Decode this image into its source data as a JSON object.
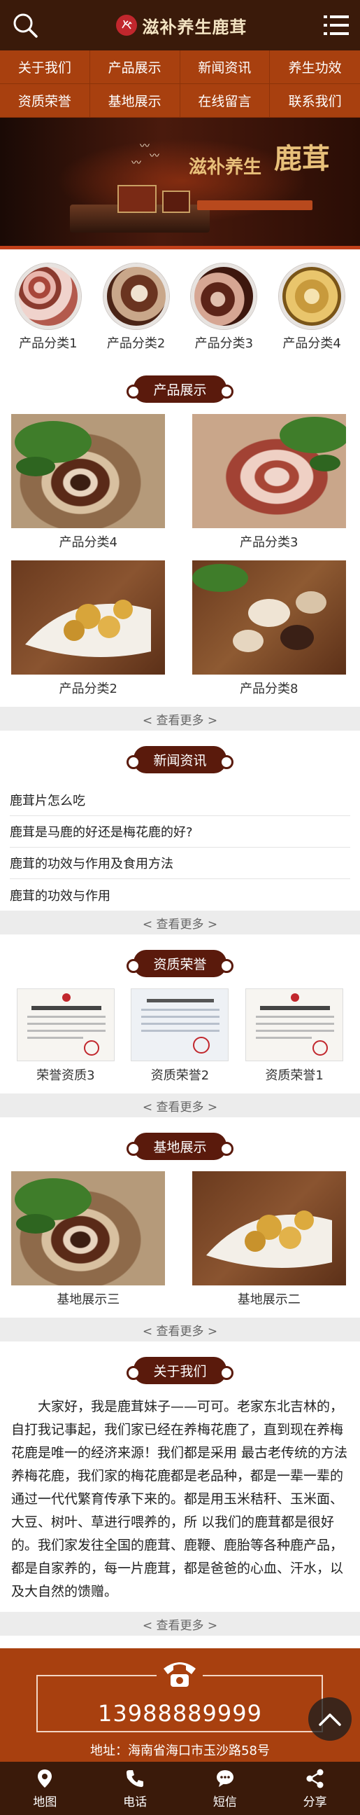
{
  "header": {
    "site_name": "滋补养生鹿茸"
  },
  "nav": {
    "items": [
      "关于我们",
      "产品展示",
      "新闻资讯",
      "养生功效",
      "资质荣誉",
      "基地展示",
      "在线留言",
      "联系我们"
    ]
  },
  "banner": {
    "brand_text": "滋补养生",
    "brand_big": "鹿茸"
  },
  "categories": {
    "items": [
      "产品分类1",
      "产品分类2",
      "产品分类3",
      "产品分类4"
    ]
  },
  "products": {
    "title": "产品展示",
    "items": [
      "产品分类4",
      "产品分类3",
      "产品分类2",
      "产品分类8"
    ],
    "more": "< 查看更多 >"
  },
  "news": {
    "title": "新闻资讯",
    "items": [
      "鹿茸片怎么吃",
      "鹿茸是马鹿的好还是梅花鹿的好?",
      "鹿茸的功效与作用及食用方法",
      "鹿茸的功效与作用"
    ],
    "more": "< 查看更多 >"
  },
  "honors": {
    "title": "资质荣誉",
    "items": [
      "荣誉资质3",
      "资质荣誉2",
      "资质荣誉1"
    ],
    "more": "< 查看更多 >"
  },
  "bases": {
    "title": "基地展示",
    "items": [
      "基地展示三",
      "基地展示二"
    ],
    "more": "< 查看更多 >"
  },
  "about": {
    "title": "关于我们",
    "text": "大家好，我是鹿茸妹子——可可。老家东北吉林的，自打我记事起，我们家已经在养梅花鹿了，直到现在养梅花鹿是唯一的经济来源！我们都是采用 最古老传统的方法养梅花鹿，我们家的梅花鹿都是老品种，都是一辈一辈的通过一代代繁育传承下来的。都是用玉米秸秆、玉米面、大豆、树叶、草进行喂养的，所 以我们的鹿茸都是很好的。我们家发往全国的鹿茸、鹿鞭、鹿胎等各种鹿产品，都是自家养的，每一片鹿茸，都是爸爸的心血、汗水，以及大自然的馈赠。",
    "more": "< 查看更多 >"
  },
  "contact": {
    "phone": "13988889999",
    "address": "地址：海南省海口市玉沙路58号"
  },
  "bottom_bar": {
    "items": [
      "地图",
      "电话",
      "短信",
      "分享"
    ]
  },
  "colors": {
    "dark_brown": "#3a1a0a",
    "nav_orange": "#a8400f",
    "title_brown": "#5a1a0c"
  }
}
